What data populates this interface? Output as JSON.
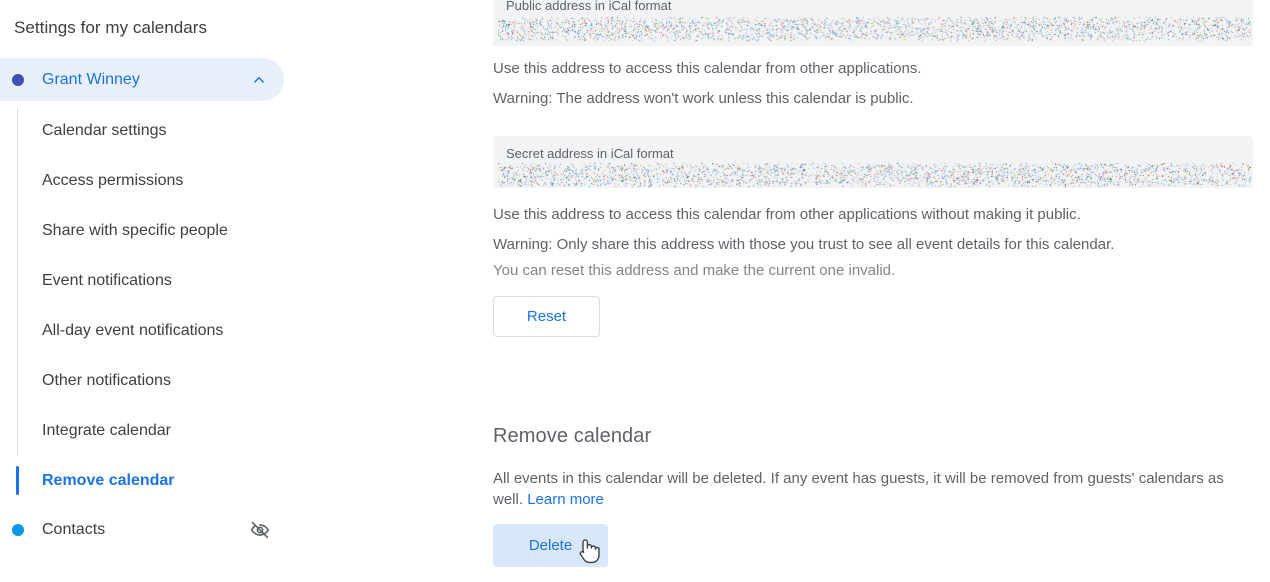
{
  "sidebar": {
    "title": "Settings for my calendars",
    "calendar_group": {
      "name": "Grant Winney",
      "dot_color": "#3f51b5",
      "expand_icon": "chevron-up-icon",
      "background": "#e8f0fe",
      "text_color": "#1a73e8"
    },
    "items": [
      {
        "label": "Calendar settings",
        "active": false
      },
      {
        "label": "Access permissions",
        "active": false
      },
      {
        "label": "Share with specific people",
        "active": false
      },
      {
        "label": "Event notifications",
        "active": false
      },
      {
        "label": "All-day event notifications",
        "active": false
      },
      {
        "label": "Other notifications",
        "active": false
      },
      {
        "label": "Integrate calendar",
        "active": false
      },
      {
        "label": "Remove calendar",
        "active": true
      }
    ],
    "contacts": {
      "label": "Contacts",
      "dot_color": "#039be5",
      "visibility_icon": "eye-off-icon"
    }
  },
  "main": {
    "public_address": {
      "label": "Public address in iCal format",
      "value": "",
      "value_redacted": true,
      "helper": "Use this address to access this calendar from other applications.",
      "warning": "Warning: The address won't work unless this calendar is public."
    },
    "secret_address": {
      "label": "Secret address in iCal format",
      "value": "",
      "value_redacted": true,
      "helper": "Use this address to access this calendar from other applications without making it public.",
      "warning": "Warning: Only share this address with those you trust to see all event details for this calendar.",
      "note": "You can reset this address and make the current one invalid.",
      "reset_label": "Reset"
    },
    "remove_calendar": {
      "title": "Remove calendar",
      "description_part1": "All events in this calendar will be deleted. If any event has guests, it will be removed from guests' calendars as well. ",
      "learn_more_label": "Learn more",
      "delete_label": "Delete"
    }
  },
  "colors": {
    "accent": "#1a73e8",
    "field_background": "#f1f3f4",
    "selected_background": "#e8f0fe",
    "hover_background": "#d9e7fd",
    "text_primary": "#3c4043",
    "text_secondary": "#5f6368",
    "rail": "#dadce0"
  }
}
